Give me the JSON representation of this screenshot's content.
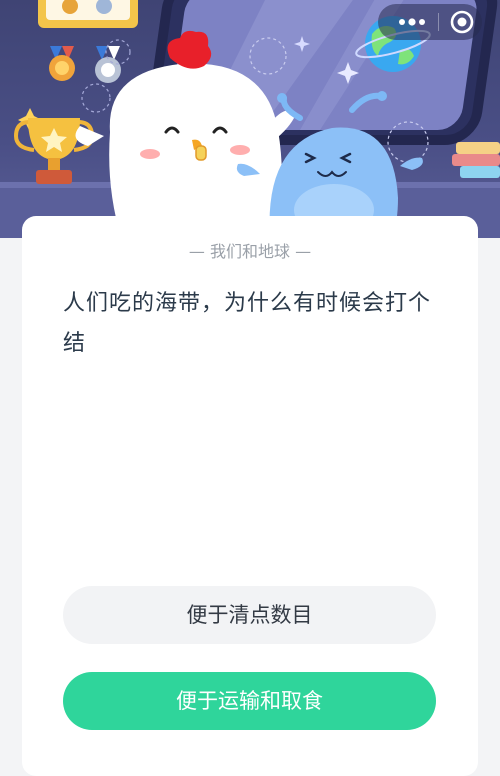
{
  "colors": {
    "hero_bg": "#454a7e",
    "card_bg": "#ffffff",
    "option_neutral_bg": "#f2f3f5",
    "option_accent_bg": "#2fd59b",
    "text_primary": "#2b3a4a",
    "text_muted": "#9aa0a8"
  },
  "mini_program_capsule": {
    "menu_icon": "more-dots-icon",
    "close_icon": "close-circle-icon"
  },
  "hero": {
    "illustration": [
      "chicken-mascot",
      "blue-creature-mascot",
      "trophy",
      "medals",
      "window-earth",
      "books"
    ]
  },
  "quiz": {
    "category": "— 我们和地球 —",
    "question": "人们吃的海带，为什么有时候会打个结",
    "options": [
      {
        "label": "便于清点数目"
      },
      {
        "label": "便于运输和取食"
      }
    ]
  }
}
